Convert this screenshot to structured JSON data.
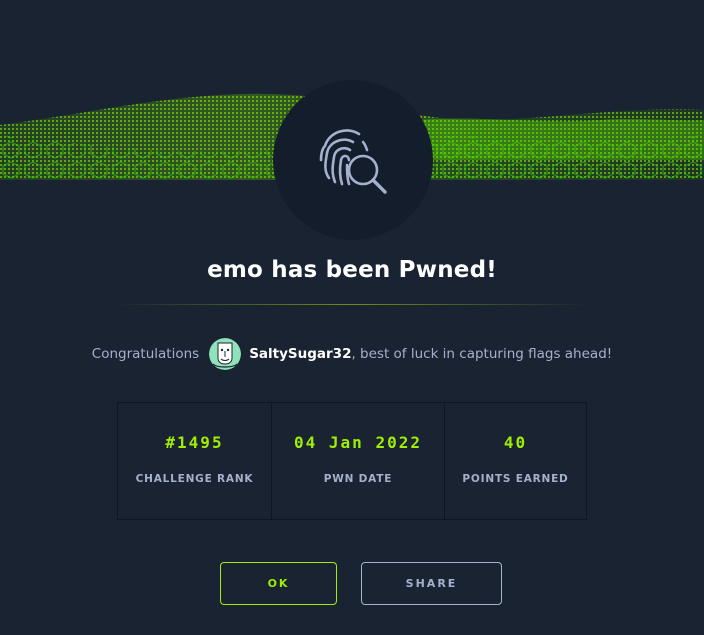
{
  "dialog": {
    "title": "emo has been Pwned!",
    "badge_icon": "fingerprint-search-icon"
  },
  "congrats": {
    "prefix": "Congratulations",
    "avatar_icon": "user-avatar",
    "username": "SaltySugar32",
    "suffix": ", best of luck in capturing flags ahead!"
  },
  "stats": [
    {
      "value": "#1495",
      "label": "CHALLENGE RANK"
    },
    {
      "value": "04 Jan 2022",
      "label": "PWN DATE"
    },
    {
      "value": "40",
      "label": "POINTS EARNED"
    }
  ],
  "buttons": {
    "ok_label": "OK",
    "share_label": "SHARE"
  },
  "colors": {
    "accent": "#9fef00",
    "background": "#1a2332",
    "circle": "#141d2b",
    "text_muted": "#a4b1cd"
  }
}
